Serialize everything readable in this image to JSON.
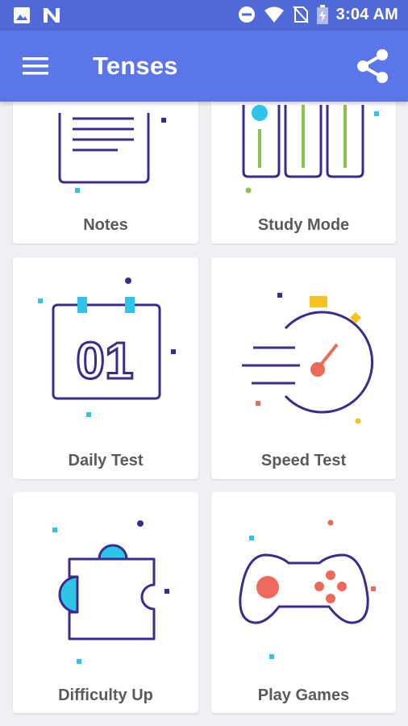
{
  "status_bar": {
    "time": "3:04 AM",
    "icons": [
      "image-icon",
      "n-app-icon",
      "do-not-disturb-icon",
      "wifi-icon",
      "no-sim-icon",
      "battery-charging-icon"
    ]
  },
  "app_bar": {
    "title": "Tenses",
    "menu_icon": "hamburger-menu-icon",
    "share_icon": "share-icon"
  },
  "cards": [
    {
      "label": "Notes",
      "icon": "notes-icon"
    },
    {
      "label": "Study Mode",
      "icon": "study-mode-icon"
    },
    {
      "label": "Daily Test",
      "icon": "calendar-01-icon"
    },
    {
      "label": "Speed Test",
      "icon": "speedometer-icon"
    },
    {
      "label": "Difficulty Up",
      "icon": "puzzle-icon"
    },
    {
      "label": "Play Games",
      "icon": "gamepad-icon"
    }
  ],
  "daily_test_date": "01",
  "colors": {
    "status_bar": "#5069d8",
    "app_bar": "#5b76e6",
    "line_purple": "#3c2a8c",
    "accent_cyan": "#2dc6e8",
    "accent_green": "#8bc34a",
    "accent_coral": "#ec6a5c",
    "accent_yellow": "#f6c21d"
  }
}
